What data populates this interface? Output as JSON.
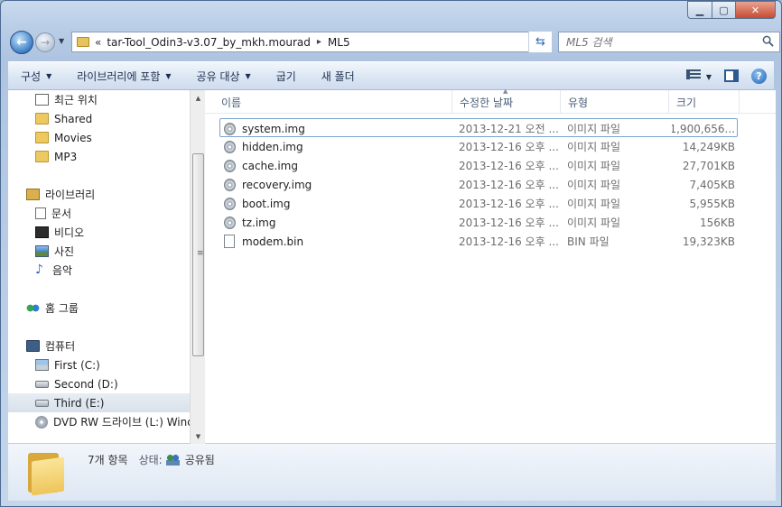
{
  "window": {
    "address": {
      "overflow": "«",
      "crumbs": [
        "tar-Tool_Odin3-v3.07_by_mkh.mourad",
        "ML5"
      ],
      "separator": "▸"
    },
    "search": {
      "placeholder": "ML5 검색"
    }
  },
  "toolbar": {
    "organize": "구성",
    "include_library": "라이브러리에 포함",
    "share_with": "공유 대상",
    "burn": "굽기",
    "new_folder": "새 폴더"
  },
  "nav": [
    {
      "label": "최근 위치",
      "icon": "recent-places-icon"
    },
    {
      "label": "Shared",
      "icon": "folder-icon"
    },
    {
      "label": "Movies",
      "icon": "folder-icon"
    },
    {
      "label": "MP3",
      "icon": "folder-icon"
    },
    {
      "label": "라이브러리",
      "icon": "library-icon"
    },
    {
      "label": "문서",
      "icon": "documents-icon"
    },
    {
      "label": "비디오",
      "icon": "video-icon"
    },
    {
      "label": "사진",
      "icon": "pictures-icon"
    },
    {
      "label": "음악",
      "icon": "music-icon"
    },
    {
      "label": "홈 그룹",
      "icon": "homegroup-icon"
    },
    {
      "label": "컴퓨터",
      "icon": "computer-icon"
    },
    {
      "label": "First (C:)",
      "icon": "drive-c-icon"
    },
    {
      "label": "Second (D:)",
      "icon": "drive-icon"
    },
    {
      "label": "Third (E:)",
      "icon": "drive-icon"
    },
    {
      "label": "DVD RW 드라이브 (L:) Windows",
      "icon": "dvd-icon"
    }
  ],
  "columns": {
    "name": "이름",
    "modified": "수정한 날짜",
    "type": "유형",
    "size": "크기"
  },
  "files": [
    {
      "name": "system.img",
      "modified": "2013-12-21 오전 ...",
      "type": "이미지 파일",
      "size": "1,900,656..."
    },
    {
      "name": "hidden.img",
      "modified": "2013-12-16 오후 ...",
      "type": "이미지 파일",
      "size": "14,249KB"
    },
    {
      "name": "cache.img",
      "modified": "2013-12-16 오후 ...",
      "type": "이미지 파일",
      "size": "27,701KB"
    },
    {
      "name": "recovery.img",
      "modified": "2013-12-16 오후 ...",
      "type": "이미지 파일",
      "size": "7,405KB"
    },
    {
      "name": "boot.img",
      "modified": "2013-12-16 오후 ...",
      "type": "이미지 파일",
      "size": "5,955KB"
    },
    {
      "name": "tz.img",
      "modified": "2013-12-16 오후 ...",
      "type": "이미지 파일",
      "size": "156KB"
    },
    {
      "name": "modem.bin",
      "modified": "2013-12-16 오후 ...",
      "type": "BIN 파일",
      "size": "19,323KB"
    }
  ],
  "details": {
    "count": "7개 항목",
    "state_label": "상태:",
    "state_value": "공유됨"
  }
}
